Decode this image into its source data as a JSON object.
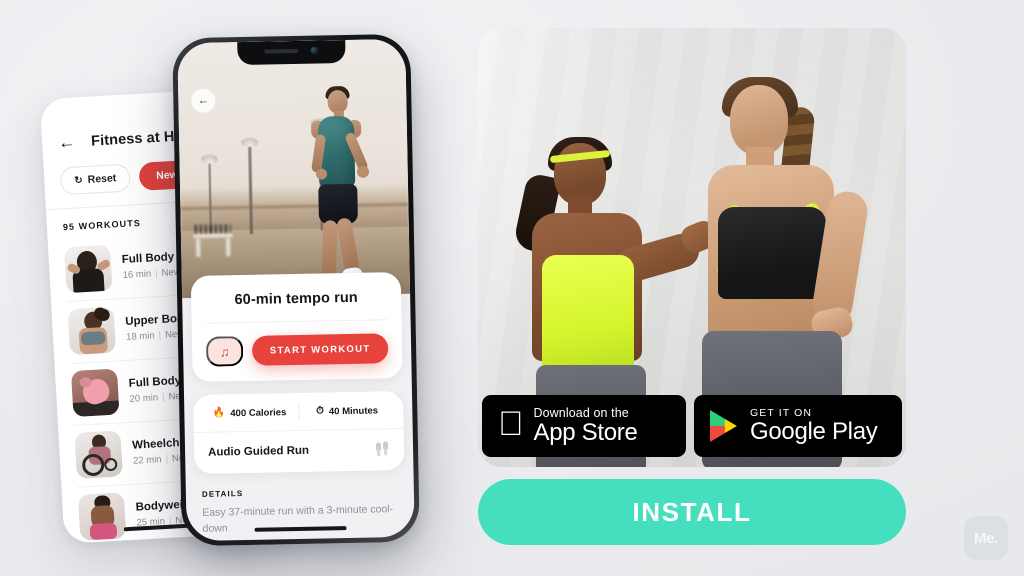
{
  "theme": {
    "background": "#edeef0",
    "accent_red": "#e8423c",
    "accent_mint": "#45dfc0",
    "lime": "#d9f43a",
    "dark": "#15171a"
  },
  "back_phone": {
    "back_icon": "arrow-left-icon",
    "title": "Fitness at Home",
    "filters": [
      {
        "id": "reset",
        "label": "Reset",
        "icon": "refresh-icon"
      },
      {
        "id": "level",
        "label": "Newbie"
      }
    ],
    "section_count": "95 WORKOUTS",
    "workouts": [
      {
        "name": "Full Body Set",
        "duration": "16 min",
        "level": "Newbie"
      },
      {
        "name": "Upper Body Exercise",
        "duration": "18 min",
        "level": "Newbie"
      },
      {
        "name": "Full Body Burn",
        "duration": "20 min",
        "level": "Newbie"
      },
      {
        "name": "Wheelchair Cardio",
        "duration": "22 min",
        "level": "Newbie"
      },
      {
        "name": "Bodyweight Workout",
        "duration": "25 min",
        "level": "Newbie"
      }
    ]
  },
  "front_phone": {
    "back_icon": "arrow-left-icon",
    "hero_image": "man-running-on-boardwalk",
    "workout_title": "60-min tempo run",
    "music_icon": "music-note-icon",
    "start_label": "START WORKOUT",
    "stats": [
      {
        "icon": "flame-icon",
        "glyph": "🔥",
        "value": "400 Calories"
      },
      {
        "icon": "stopwatch-icon",
        "glyph": "⏱",
        "value": "40 Minutes"
      }
    ],
    "audio_row": {
      "label": "Audio Guided Run",
      "icon": "earbuds-icon"
    },
    "details_heading": "DETAILS",
    "details_text": "Easy 37-minute run with a 3-minute cool-down"
  },
  "promo": {
    "photo_alt": "two-smiling-women-in-sportswear",
    "store_badges": [
      {
        "id": "app-store",
        "icon": "apple-logo-icon",
        "small_text": "Download on the",
        "big_text": "App Store"
      },
      {
        "id": "google-play",
        "icon": "google-play-icon",
        "small_text": "GET IT ON",
        "big_text": "Google Play"
      }
    ],
    "install_label": "INSTALL"
  },
  "watermark": {
    "label": "Me."
  }
}
